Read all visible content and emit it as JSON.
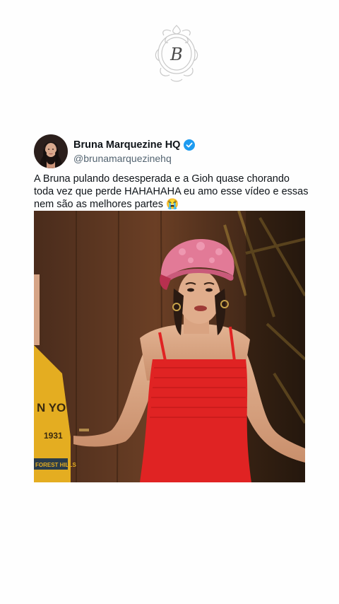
{
  "account": {
    "display_name": "Bruna Marquezine HQ",
    "handle": "@brunamarquezinehq",
    "verified": true
  },
  "tweet": {
    "text": "A Bruna pulando desesperada e a Gioh quase chorando toda vez que perde HAHAHAHA eu amo esse vídeo e essas nem são as melhores partes 😭"
  },
  "media": {
    "shirt_text_line1": "N YO",
    "shirt_text_line2": "1931",
    "shirt_text_line3": "FOREST HILLS"
  },
  "logo": {
    "monogram": "B"
  },
  "colors": {
    "verified_blue": "#1d9bf0",
    "dress_red": "#e02323",
    "cap_pink": "#e27a97"
  }
}
